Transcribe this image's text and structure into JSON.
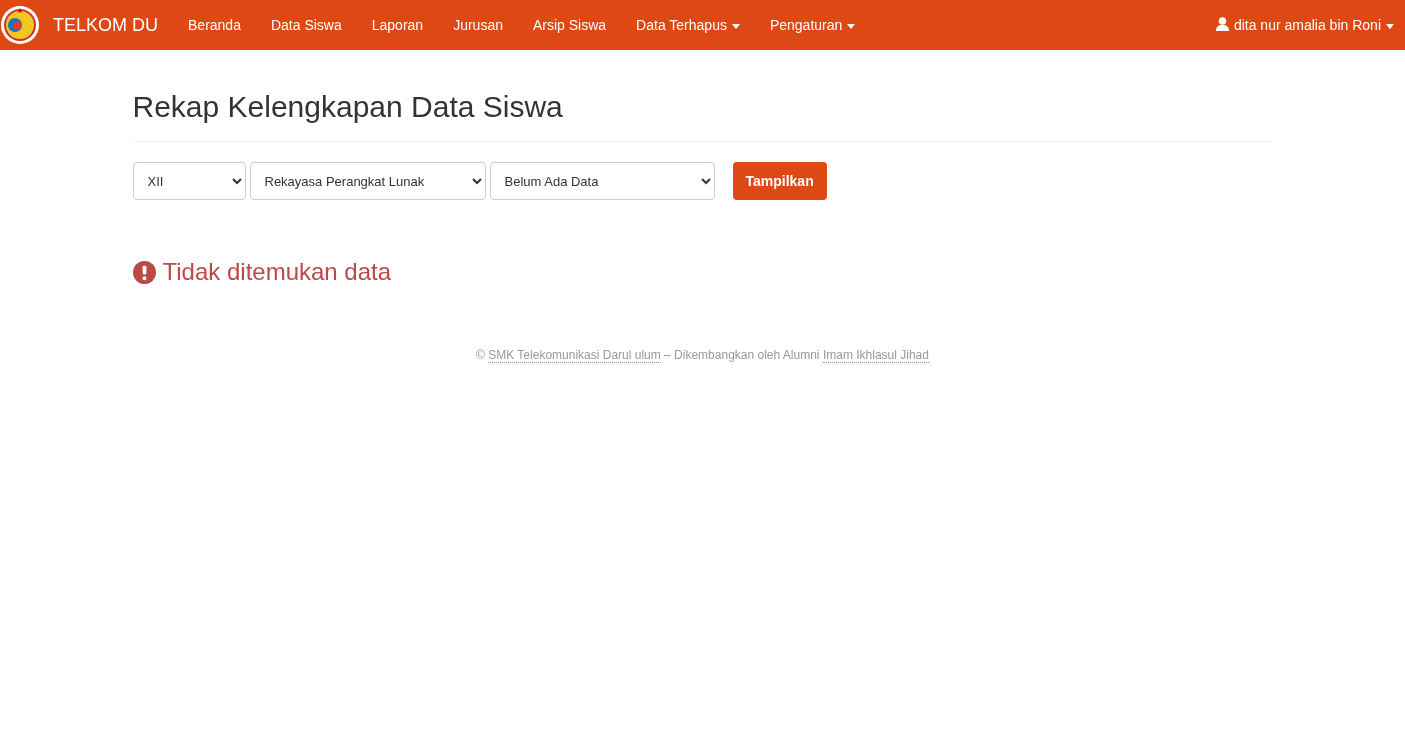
{
  "navbar": {
    "brand": "TELKOM DU",
    "items": [
      {
        "label": "Beranda",
        "kind": "link"
      },
      {
        "label": "Data Siswa",
        "kind": "link"
      },
      {
        "label": "Laporan",
        "kind": "link"
      },
      {
        "label": "Jurusan",
        "kind": "link"
      },
      {
        "label": "Arsip Siswa",
        "kind": "link"
      },
      {
        "label": "Data Terhapus",
        "kind": "dropdown"
      },
      {
        "label": "Pengaturan",
        "kind": "dropdown"
      }
    ],
    "user": {
      "label": "dita nur amalia bin Roni",
      "kind": "dropdown"
    }
  },
  "page_title": "Rekap Kelengkapan Data Siswa",
  "filters": [
    {
      "value": "XII"
    },
    {
      "value": "Rekayasa Perangkat Lunak"
    },
    {
      "value": "Belum Ada Data"
    }
  ],
  "submit_button": "Tampilkan",
  "message": "Tidak ditemukan data",
  "footer": {
    "prefix": "©",
    "school_link": "SMK Telekomunikasi Darul ulum",
    "middle": "– Dikembangkan oleh Alumni",
    "author_link": "Imam Ikhlasul Jihad"
  }
}
